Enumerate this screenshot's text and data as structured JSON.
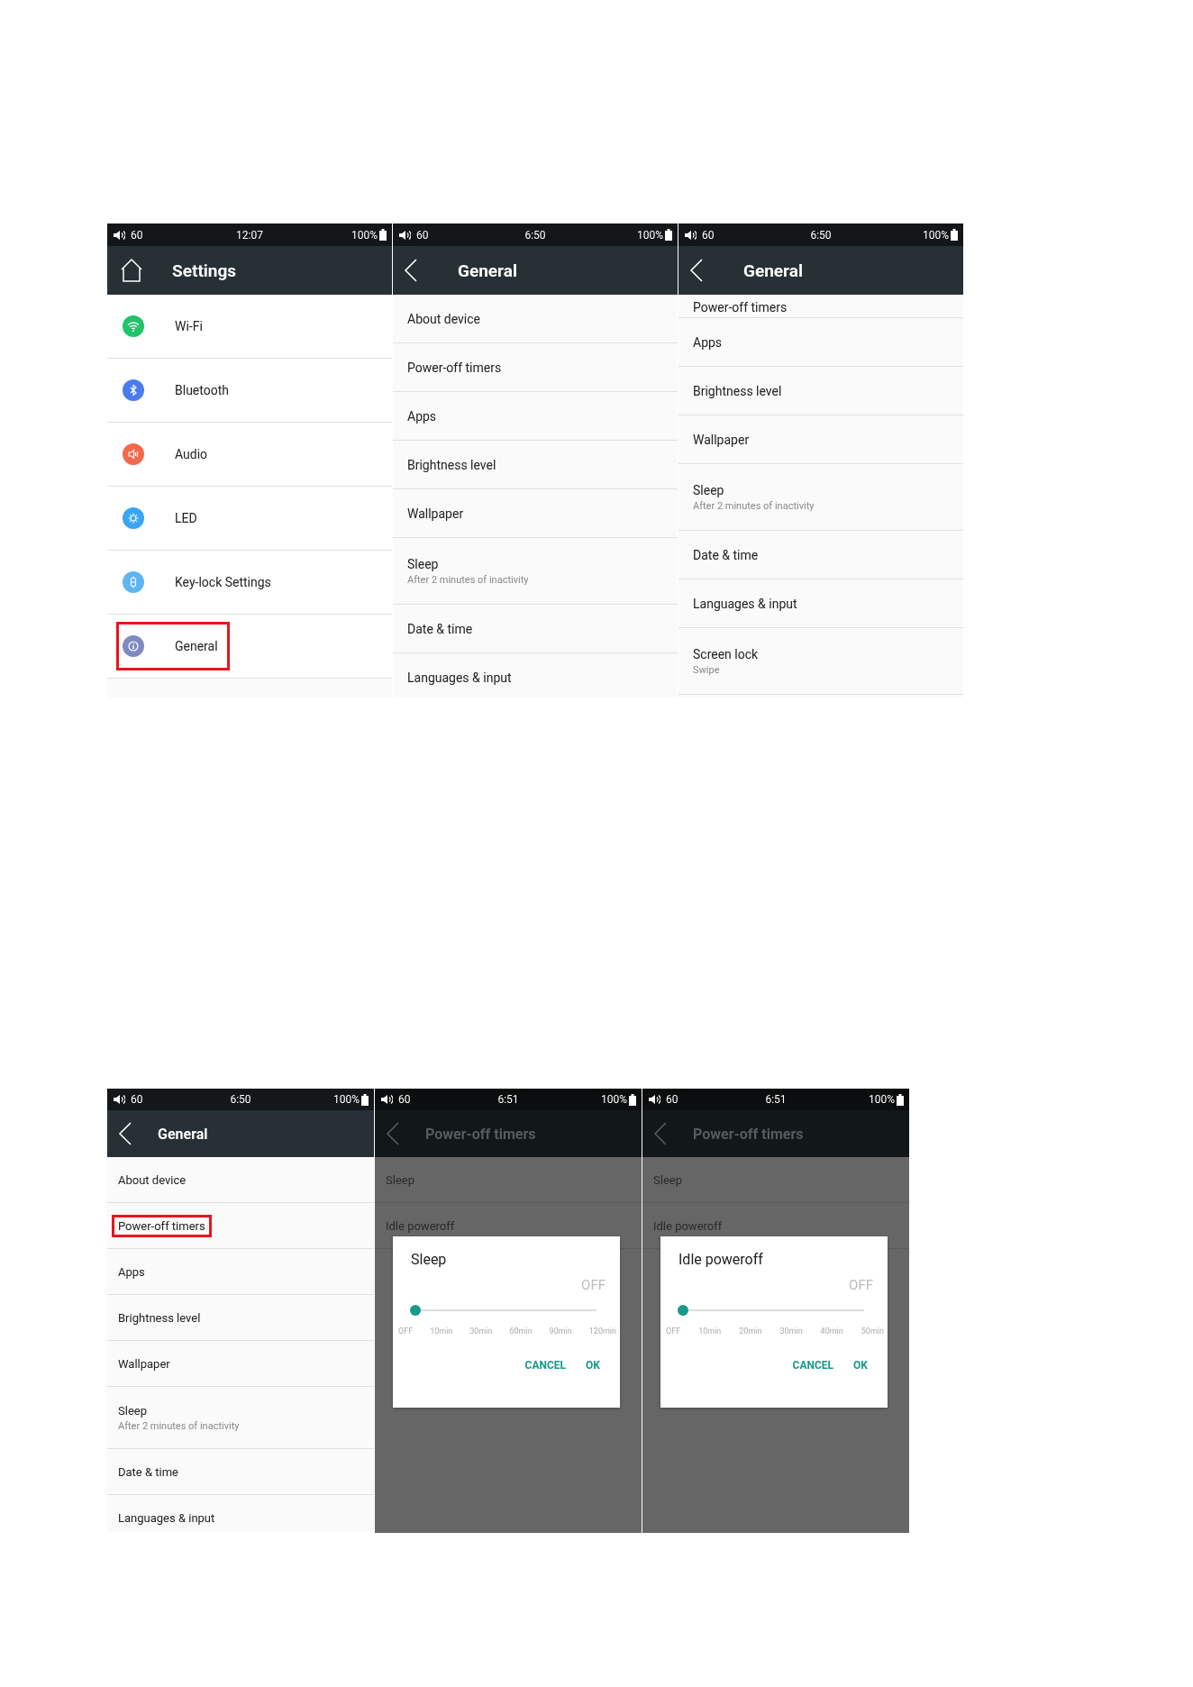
{
  "rows": [
    {
      "screens": [
        {
          "status_bar": {
            "volume": "60",
            "time": "12:07",
            "battery": "100%"
          },
          "header": {
            "button": {
              "kind": "home"
            },
            "title": "Settings"
          },
          "dimmed": false,
          "list": [
            {
              "label": "Wi-Fi",
              "color": "#1fc46b",
              "highlighted": false
            },
            {
              "label": "Bluetooth",
              "color": "#4a7cf0",
              "highlighted": false
            },
            {
              "label": "Audio",
              "color": "#f2694c",
              "highlighted": false
            },
            {
              "label": "LED",
              "color": "#3aa4f5",
              "highlighted": false
            },
            {
              "label": "Key-lock Settings",
              "color": "#5fb4f2",
              "highlighted": false
            },
            {
              "label": "General",
              "color": "#7f8bbf",
              "highlighted": true
            }
          ]
        },
        {
          "status_bar": {
            "volume": "60",
            "time": "6:50",
            "battery": "100%"
          },
          "header": {
            "button": {
              "kind": "back"
            },
            "title": "General"
          },
          "dimmed": false,
          "list": [
            {
              "label": "About device",
              "highlighted": false
            },
            {
              "label": "Power-off timers",
              "highlighted": false
            },
            {
              "label": "Apps",
              "highlighted": false
            },
            {
              "label": "Brightness level",
              "highlighted": false
            },
            {
              "label": "Wallpaper",
              "highlighted": false
            },
            {
              "label": "Sleep",
              "subtitle": "After 2 minutes of inactivity",
              "highlighted": false
            },
            {
              "label": "Date & time",
              "highlighted": false
            },
            {
              "label": "Languages & input",
              "highlighted": false
            }
          ]
        },
        {
          "status_bar": {
            "volume": "60",
            "time": "6:50",
            "battery": "100%"
          },
          "header": {
            "button": {
              "kind": "back"
            },
            "title": "General"
          },
          "dimmed": false,
          "list": [
            {
              "label": "Power-off timers",
              "highlighted": false,
              "cut_off": true
            },
            {
              "label": "Apps",
              "highlighted": false
            },
            {
              "label": "Brightness level",
              "highlighted": false
            },
            {
              "label": "Wallpaper",
              "highlighted": false
            },
            {
              "label": "Sleep",
              "subtitle": "After 2 minutes of inactivity",
              "highlighted": false
            },
            {
              "label": "Date & time",
              "highlighted": false
            },
            {
              "label": "Languages & input",
              "highlighted": false
            },
            {
              "label": "Screen lock",
              "subtitle": "Swipe",
              "highlighted": false
            }
          ]
        }
      ]
    },
    {
      "screens": [
        {
          "status_bar": {
            "volume": "60",
            "time": "6:50",
            "battery": "100%"
          },
          "header": {
            "button": {
              "kind": "back"
            },
            "title": "General"
          },
          "dimmed": false,
          "list": [
            {
              "label": "About device",
              "highlighted": false
            },
            {
              "label": "Power-off timers",
              "highlighted": true
            },
            {
              "label": "Apps",
              "highlighted": false
            },
            {
              "label": "Brightness level",
              "highlighted": false
            },
            {
              "label": "Wallpaper",
              "highlighted": false
            },
            {
              "label": "Sleep",
              "subtitle": "After 2 minutes of inactivity",
              "highlighted": false
            },
            {
              "label": "Date & time",
              "highlighted": false
            },
            {
              "label": "Languages & input",
              "highlighted": false
            }
          ]
        },
        {
          "status_bar": {
            "volume": "60",
            "time": "6:51",
            "battery": "100%"
          },
          "header": {
            "button": {
              "kind": "back"
            },
            "title": "Power-off timers"
          },
          "dimmed": true,
          "list": [
            {
              "label": "Sleep",
              "highlighted": false
            },
            {
              "label": "Idle poweroff",
              "highlighted": false
            }
          ],
          "dialog": {
            "title": "Sleep",
            "value": "OFF",
            "level": 0,
            "ticks": [
              "OFF",
              "10min",
              "30min",
              "60min",
              "90min",
              "120min"
            ],
            "buttons": [
              "CANCEL",
              "OK"
            ]
          }
        },
        {
          "status_bar": {
            "volume": "60",
            "time": "6:51",
            "battery": "100%"
          },
          "header": {
            "button": {
              "kind": "back"
            },
            "title": "Power-off timers"
          },
          "dimmed": true,
          "list": [
            {
              "label": "Sleep",
              "highlighted": false
            },
            {
              "label": "Idle poweroff",
              "highlighted": false
            }
          ],
          "dialog": {
            "title": "Idle poweroff",
            "value": "OFF",
            "level": 0,
            "ticks": [
              "OFF",
              "10min",
              "20min",
              "30min",
              "40min",
              "50min"
            ],
            "buttons": [
              "CANCEL",
              "OK"
            ]
          }
        }
      ]
    }
  ]
}
